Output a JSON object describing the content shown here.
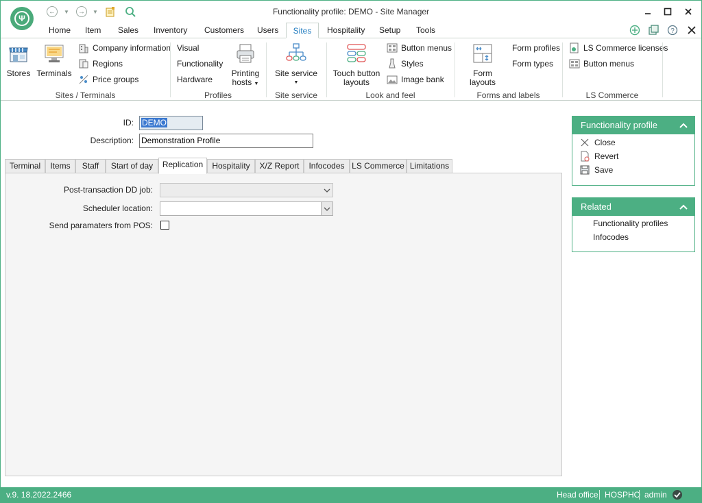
{
  "window": {
    "title": "Functionality profile: DEMO - Site Manager"
  },
  "menu_tabs": [
    "Home",
    "Item",
    "Sales",
    "Inventory",
    "Customers",
    "Users",
    "Sites",
    "Hospitality",
    "Setup",
    "Tools"
  ],
  "active_menu_tab": "Sites",
  "ribbon": {
    "sites_terminals": {
      "label": "Sites / Terminals",
      "stores": "Stores",
      "terminals": "Terminals",
      "company_information": "Company information",
      "regions": "Regions",
      "price_groups": "Price groups"
    },
    "profiles": {
      "label": "Profiles",
      "visual": "Visual",
      "functionality": "Functionality",
      "hardware": "Hardware",
      "printing_hosts_line1": "Printing",
      "printing_hosts_line2": "hosts"
    },
    "site_service": {
      "label": "Site service",
      "button": "Site service"
    },
    "look_and_feel": {
      "label": "Look and feel",
      "touch_line1": "Touch button",
      "touch_line2": "layouts",
      "button_menus": "Button menus",
      "styles": "Styles",
      "image_bank": "Image bank"
    },
    "forms_labels": {
      "label": "Forms and labels",
      "form_layouts": "Form layouts",
      "form_profiles": "Form profiles",
      "form_types": "Form types"
    },
    "ls_commerce": {
      "label": "LS Commerce",
      "licenses": "LS Commerce licenses",
      "button_menus": "Button menus"
    }
  },
  "form": {
    "id_label": "ID:",
    "id_value": "DEMO",
    "description_label": "Description:",
    "description_value": "Demonstration Profile"
  },
  "form_tabs": [
    "Terminal",
    "Items",
    "Staff",
    "Start of day",
    "Replication",
    "Hospitality",
    "X/Z Report",
    "Infocodes",
    "LS Commerce",
    "Limitations"
  ],
  "active_form_tab": "Replication",
  "replication": {
    "post_transaction_label": "Post-transaction DD job:",
    "post_transaction_value": "",
    "scheduler_location_label": "Scheduler location:",
    "scheduler_location_value": "",
    "send_parameters_label": "Send paramaters from POS:",
    "send_parameters_checked": false
  },
  "side_panel": {
    "title": "Functionality profile",
    "close": "Close",
    "revert": "Revert",
    "save": "Save"
  },
  "related_panel": {
    "title": "Related",
    "items": [
      "Functionality profiles",
      "Infocodes"
    ]
  },
  "status_bar": {
    "version": "v.9. 18.2022.2466",
    "location": "Head office",
    "company": "HOSPHO",
    "user": "admin"
  },
  "colors": {
    "accent": "#4caf83",
    "active_tab_text": "#1f7bbf",
    "selection": "#3a78d0"
  }
}
